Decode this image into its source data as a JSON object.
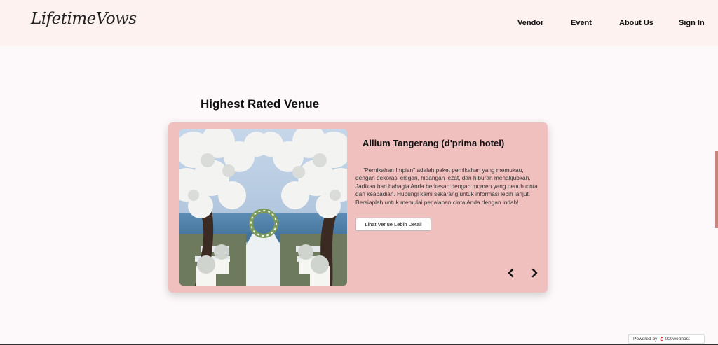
{
  "header": {
    "logo": "LifetimeVows",
    "nav": [
      {
        "label": "Vendor"
      },
      {
        "label": "Event"
      },
      {
        "label": "About Us"
      },
      {
        "label": "Sign In"
      }
    ]
  },
  "section": {
    "title": "Highest Rated Venue"
  },
  "venue": {
    "name": "Allium Tangerang (d'prima hotel)",
    "description": "\"Pernikahan Impian\" adalah paket pernikahan yang memukau, dengan dekorasi elegan, hidangan lezat, dan hiburan menakjubkan. Jadikan hari bahagia Anda berkesan dengan momen yang penuh cinta dan keabadian. Hubungi kami sekarang untuk informasi lebih lanjut. Bersiaplah untuk memulai perjalanan cinta Anda dengan indah!",
    "detail_button": "Lihat Venue Lebih Detail",
    "image_icon": "wedding-venue-photo"
  },
  "carousel": {
    "prev_icon": "chevron-left-icon",
    "next_icon": "chevron-right-icon"
  },
  "footer_badge": {
    "prefix": "Powered by",
    "brand": "000webhost"
  },
  "colors": {
    "header_bg": "#fdf2f0",
    "page_bg": "#fdf8fa",
    "card_bg": "#f0c0bf",
    "accent": "#c98680"
  }
}
